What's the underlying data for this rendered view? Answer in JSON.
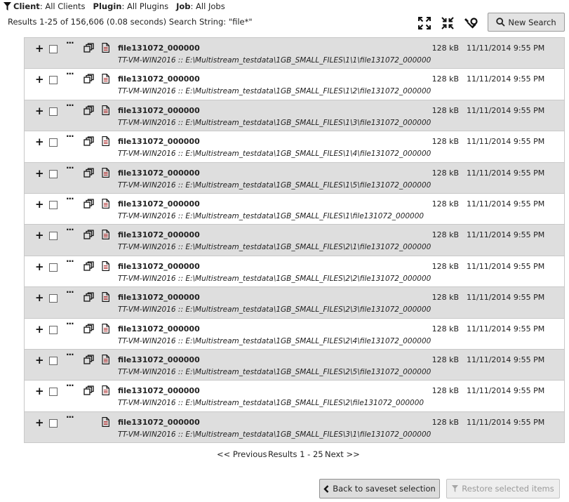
{
  "filters": {
    "client_label": "Client",
    "client_value": ": All Clients",
    "plugin_label": "Plugin",
    "plugin_value": ": All Plugins",
    "job_label": "Job",
    "job_value": ": All Jobs"
  },
  "summary": "Results 1-25 of 156,606 (0.08 seconds) Search String: \"file*\"",
  "toolbar": {
    "new_search_label": "New Search",
    "icons": [
      "expand-icon",
      "collapse-icon",
      "tools-icon",
      "search-icon"
    ]
  },
  "rows": [
    {
      "name": "file131072_000000",
      "path": "TT-VM-WIN2016 :: E:\\Multistream_testdata\\1GB_SMALL_FILES\\1\\1\\file131072_000000",
      "size": "128 kB",
      "date": "11/11/2014 9:55 PM",
      "versions": true
    },
    {
      "name": "file131072_000000",
      "path": "TT-VM-WIN2016 :: E:\\Multistream_testdata\\1GB_SMALL_FILES\\1\\2\\file131072_000000",
      "size": "128 kB",
      "date": "11/11/2014 9:55 PM",
      "versions": true
    },
    {
      "name": "file131072_000000",
      "path": "TT-VM-WIN2016 :: E:\\Multistream_testdata\\1GB_SMALL_FILES\\1\\3\\file131072_000000",
      "size": "128 kB",
      "date": "11/11/2014 9:55 PM",
      "versions": true
    },
    {
      "name": "file131072_000000",
      "path": "TT-VM-WIN2016 :: E:\\Multistream_testdata\\1GB_SMALL_FILES\\1\\4\\file131072_000000",
      "size": "128 kB",
      "date": "11/11/2014 9:55 PM",
      "versions": true
    },
    {
      "name": "file131072_000000",
      "path": "TT-VM-WIN2016 :: E:\\Multistream_testdata\\1GB_SMALL_FILES\\1\\5\\file131072_000000",
      "size": "128 kB",
      "date": "11/11/2014 9:55 PM",
      "versions": true
    },
    {
      "name": "file131072_000000",
      "path": "TT-VM-WIN2016 :: E:\\Multistream_testdata\\1GB_SMALL_FILES\\1\\file131072_000000",
      "size": "128 kB",
      "date": "11/11/2014 9:55 PM",
      "versions": true
    },
    {
      "name": "file131072_000000",
      "path": "TT-VM-WIN2016 :: E:\\Multistream_testdata\\1GB_SMALL_FILES\\2\\1\\file131072_000000",
      "size": "128 kB",
      "date": "11/11/2014 9:55 PM",
      "versions": true
    },
    {
      "name": "file131072_000000",
      "path": "TT-VM-WIN2016 :: E:\\Multistream_testdata\\1GB_SMALL_FILES\\2\\2\\file131072_000000",
      "size": "128 kB",
      "date": "11/11/2014 9:55 PM",
      "versions": true
    },
    {
      "name": "file131072_000000",
      "path": "TT-VM-WIN2016 :: E:\\Multistream_testdata\\1GB_SMALL_FILES\\2\\3\\file131072_000000",
      "size": "128 kB",
      "date": "11/11/2014 9:55 PM",
      "versions": true
    },
    {
      "name": "file131072_000000",
      "path": "TT-VM-WIN2016 :: E:\\Multistream_testdata\\1GB_SMALL_FILES\\2\\4\\file131072_000000",
      "size": "128 kB",
      "date": "11/11/2014 9:55 PM",
      "versions": true
    },
    {
      "name": "file131072_000000",
      "path": "TT-VM-WIN2016 :: E:\\Multistream_testdata\\1GB_SMALL_FILES\\2\\5\\file131072_000000",
      "size": "128 kB",
      "date": "11/11/2014 9:55 PM",
      "versions": true
    },
    {
      "name": "file131072_000000",
      "path": "TT-VM-WIN2016 :: E:\\Multistream_testdata\\1GB_SMALL_FILES\\2\\file131072_000000",
      "size": "128 kB",
      "date": "11/11/2014 9:55 PM",
      "versions": true
    },
    {
      "name": "file131072_000000",
      "path": "TT-VM-WIN2016 :: E:\\Multistream_testdata\\1GB_SMALL_FILES\\3\\1\\file131072_000000",
      "size": "128 kB",
      "date": "11/11/2014 9:55 PM",
      "versions": false
    }
  ],
  "pager": {
    "prev": "<< Previous",
    "info_prefix": "Results ",
    "info_range": "1 - 25",
    "next": "Next >>"
  },
  "footer": {
    "back_label": "Back to saveset selection",
    "restore_label": "Restore selected items"
  }
}
